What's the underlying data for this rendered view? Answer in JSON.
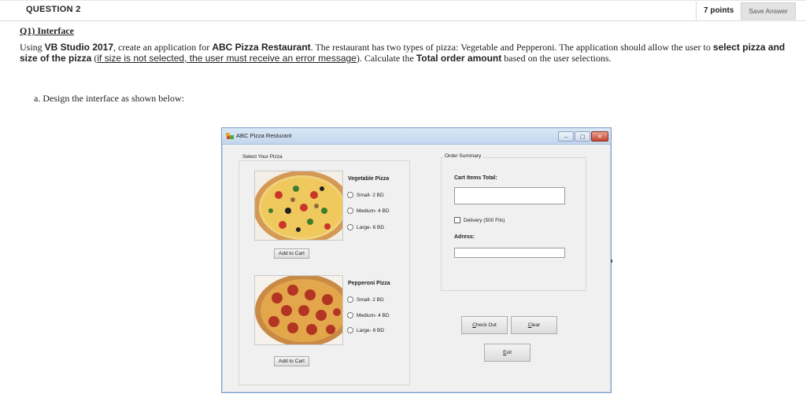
{
  "question": {
    "title": "QUESTION 2",
    "points": "7 points",
    "save_label": "Save Answer"
  },
  "content": {
    "heading": "Q1) Interface",
    "p_1": "Using ",
    "p_vb": "VB Studio 2017",
    "p_2": ", create an application for ",
    "p_abc": "ABC Pizza Restaurant",
    "p_3": ". The restaurant has two types of pizza: Vegetable and Pepperoni. The application should allow the user to ",
    "p_select": "select pizza and size of the pizza",
    "p_4": " (",
    "p_error": "if size is not selected, the user must receive an error message",
    "p_5": "). Calculate the ",
    "p_total": "Total order amount",
    "p_6": " based on the user selections.",
    "part_a": "a. Design the interface as shown below:"
  },
  "form": {
    "title": "ABC Pizza Resturant",
    "select_group": "Select Your Pizza",
    "summary_group": "Order Summary",
    "veg": {
      "title": "Vegetable Pizza",
      "small": "Small- 2 BD",
      "medium": "Medium- 4 BD",
      "large": "Large- 6 BD",
      "add": "Add to Cart"
    },
    "pep": {
      "title": "Pepperoni Pizza",
      "small": "Small- 2 BD",
      "medium": "Medium- 4 BD",
      "large": "Large- 6 BD",
      "add": "Add to Cart"
    },
    "cart_total_label": "Cart Items Total:",
    "delivery": "Delivery (500 Fils)",
    "address_label": "Adress:",
    "checkout_first": "C",
    "checkout_rest": "heck Out",
    "clear_first": "C",
    "clear_rest": "lear",
    "exit_first": "E",
    "exit_rest": "xit"
  },
  "colors": {
    "window_border": "#7a9cc7",
    "form_bg": "#f0f0f0",
    "close_button": "#c64732"
  }
}
